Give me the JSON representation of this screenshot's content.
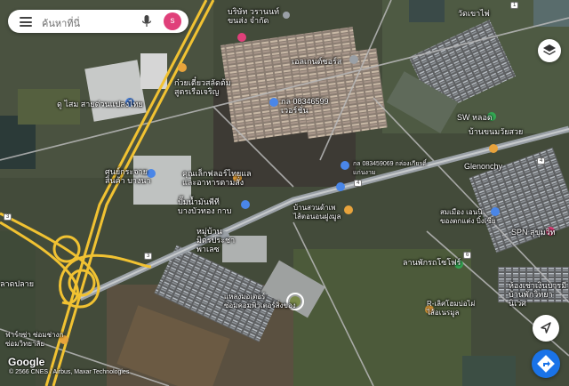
{
  "search": {
    "placeholder": "ค้นหาที่นี่",
    "avatar_initial": "s"
  },
  "map_labels": [
    {
      "id": "company-transport",
      "text": "บริษัท วรานนท์\nขนส่ง จำกัด"
    },
    {
      "id": "watkhao",
      "text": "วัดเขาไพ่"
    },
    {
      "id": "elegance",
      "text": "เอลเกนต์ซอร์ส"
    },
    {
      "id": "kuaytiew",
      "text": "ก๋วยเตี๋ยวสลัดต้ม\nสูตรเรือเจริญ"
    },
    {
      "id": "phone-shop1",
      "text": "กล 08346599\nเวอร์ชั่น"
    },
    {
      "id": "dusam",
      "text": "ดู ไสม สายด่วนแปลงไทย"
    },
    {
      "id": "sw-place",
      "text": "SW หลอด"
    },
    {
      "id": "bankhanom",
      "text": "บ้านขนมวัยสวย"
    },
    {
      "id": "distribution",
      "text": "ศูนย์กระจาย\nสินค้า บางนา"
    },
    {
      "id": "phone-shop2",
      "text": "กล 083459069 กล่องเกียรติ์\nแก่นงาม"
    },
    {
      "id": "glenonchy",
      "text": "Glenonchy"
    },
    {
      "id": "restaurant",
      "text": "คุณเล็กฟลอร์ไทยแล\nและอาหารตามสั่ง"
    },
    {
      "id": "gas-station",
      "text": "ปั๊มน้ำมันพีที\nบางบัวทอง กาบ"
    },
    {
      "id": "chabee",
      "text": "บ้านสวนด้าเพ\nไส้ตอนอนฝูงมูล"
    },
    {
      "id": "samanea",
      "text": "สมเมือง เอนนิ\nของตกแต่ง บิ้งเซีย"
    },
    {
      "id": "village",
      "text": "หมู่บ้าน\nมิตรประชา\nพาเลซ"
    },
    {
      "id": "spn",
      "text": "SPN สุขุมวิท"
    },
    {
      "id": "bangkok-park",
      "text": "ลานพักรถโซโฟร์"
    },
    {
      "id": "housing",
      "text": "ห้องเช่าเงินบารมี\nบ้านพักวิทยานิเวศ"
    },
    {
      "id": "flowerlab",
      "text": "แหลงมอเตอร์\nซ่อมคอมพิวเตอร์สิ่งของ"
    },
    {
      "id": "paramount",
      "text": "R-เลิศโฮมบ่อไผ่\nไส้อเนรมูล"
    },
    {
      "id": "lumpini",
      "text": "ลาดปลาย"
    },
    {
      "id": "farang",
      "text": "ฟาร์ฯซ่า ซ่อมช่างก\nซ่อมวิทยาลัย"
    }
  ],
  "road_badges": [
    "3",
    "3",
    "4",
    "1",
    "4",
    "6"
  ],
  "branding": {
    "logo": "Google",
    "attribution": "© 2566 CNES / Airbus, Maxar Technologies"
  },
  "colors": {
    "highway": "#f1c232",
    "road": "#b9b9b9",
    "accent_blue": "#1a73e8",
    "pin_orange": "#e8a33c",
    "pin_blue": "#4a86e8",
    "pin_pink": "#e0407a",
    "pin_green": "#34a853"
  },
  "icons": [
    "menu-icon",
    "mic-icon",
    "layers-icon",
    "locate-icon",
    "directions-icon"
  ]
}
